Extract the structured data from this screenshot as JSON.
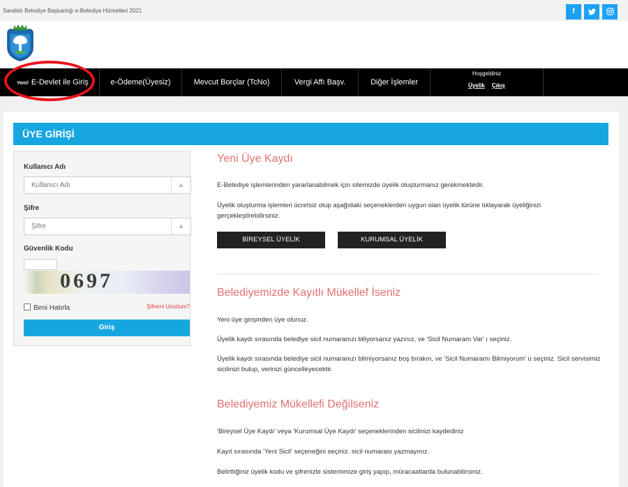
{
  "topbar": {
    "copyright": "Sandıklı Belediye Başkanlığı e-Belediye Hizmetleri 2021",
    "social": [
      {
        "icon": "facebook-icon",
        "glyph": "f"
      },
      {
        "icon": "twitter-icon",
        "glyph": "❧"
      },
      {
        "icon": "instagram-icon",
        "glyph": "◎"
      }
    ]
  },
  "nav": {
    "yeni": "Yeni!",
    "items": [
      "E-Devlet ile Giriş",
      "e-Ödeme(Üyesiz)",
      "Mevcut Borçlar (TcNo)",
      "Vergi Affı Başv.",
      "Diğer İşlemler"
    ],
    "welcome": "Hoşgeldiniz",
    "uyelik": "Üyelik",
    "cikis": "Çıkış"
  },
  "banner": "ÜYE GİRİŞİ",
  "login": {
    "username_label": "Kullanıcı Adı",
    "username_placeholder": "Kullanıcı Adı",
    "password_label": "Şifre",
    "password_placeholder": "Şifre",
    "captcha_label": "Güvenlik Kodu",
    "captcha_text": "0697",
    "remember": "Beni Hatırla",
    "forgot": "Şifremi Unuttum?",
    "submit": "Giriş"
  },
  "register": {
    "title": "Yeni Üye Kaydı",
    "p1": "E-Belediye işlemlerinden yararlanabilmek için sitemizde üyelik oluşturmanız gerekmektedir.",
    "p2": "Üyelik oluşturma işlemleri ücretsiz olup aşağıdaki seçeneklerden uygun olan üyelik türüne tıklayarak üyeliğinizi gerçekleştirebilirsiniz.",
    "btn_individual": "BİREYSEL ÜYELİK",
    "btn_corporate": "KURUMSAL ÜYELİK"
  },
  "registered": {
    "title": "Belediyemizde Kayıtlı Mükellef İseniz",
    "p1": "Yeni üye girişinden üye olunuz.",
    "p2": "Üyelik kaydı sırasında belediye sicil numaranızı biliyorsanız yazınız, ve 'Sicil Numaram Var' ı seçiniz.",
    "p3": "Üyelik kaydı sırasında belediye sicil numaranızı bilmiyorsanız boş bırakın, ve 'Sicil Numaramı Bilmiyorum' u seçiniz. Sicil servisimiz sicilinizi bulup, verinizi güncelleyecektir."
  },
  "notregistered": {
    "title": "Belediyemiz Mükellefi Değilseniz",
    "p1": "'Bireysel Üye Kaydı' veya 'Kurumsal Üye Kaydı' seçeneklerinden sicilinizi kaydediniz",
    "p2": "Kayıt sırasında 'Yeni Sicil' seçeneğini seçiniz. sicil numarası yazmayınız.",
    "p3": "Belirttiğiniz üyelik kodu ve şifrenizle sistemimize giriş yapıp, müracaatlarda bulunabilirsiniz."
  },
  "colors": {
    "accent": "#17a7e0",
    "heading": "#e07171",
    "highlight": "#e8141b",
    "nav": "#000000"
  }
}
